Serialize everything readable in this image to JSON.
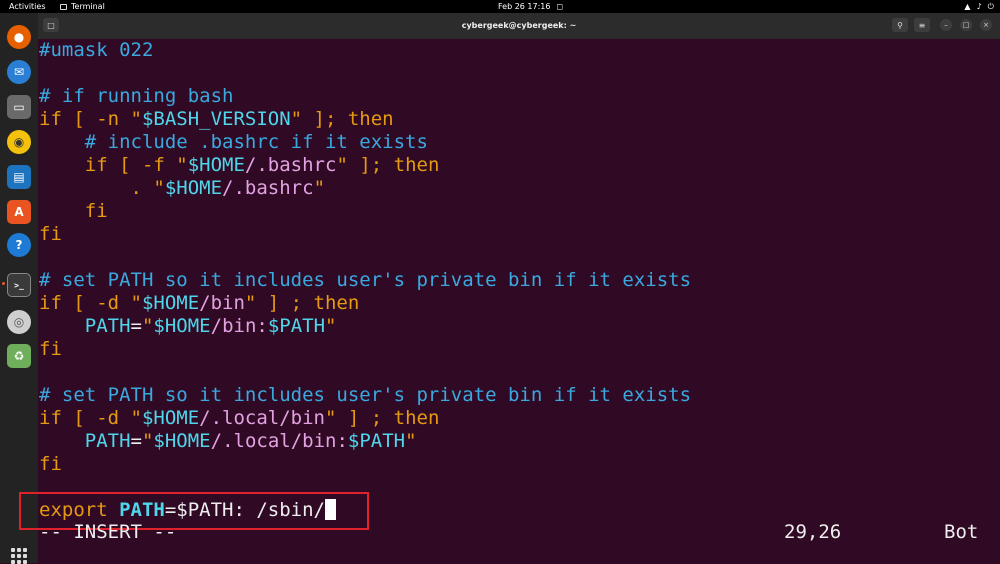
{
  "topbar": {
    "activities": "Activities",
    "app_name": "Terminal",
    "datetime": "Feb 26  17:16",
    "tray_icons": [
      "network-icon",
      "volume-icon",
      "power-icon"
    ]
  },
  "dock": {
    "apps": [
      {
        "name": "firefox",
        "icon": "firefox-icon",
        "color": "#e66000"
      },
      {
        "name": "thunderbird",
        "icon": "thunderbird-icon",
        "color": "#2a7fd4"
      },
      {
        "name": "files",
        "icon": "folder-icon",
        "color": "#6a6a6a"
      },
      {
        "name": "rhythmbox",
        "icon": "speaker-icon",
        "color": "#f4c20d"
      },
      {
        "name": "libreoffice-writer",
        "icon": "document-icon",
        "color": "#1e73be"
      },
      {
        "name": "app-center",
        "icon": "store-icon",
        "color": "#e95420"
      },
      {
        "name": "help",
        "icon": "help-icon",
        "color": "#1d7bd6"
      },
      {
        "name": "terminal",
        "icon": "terminal-icon",
        "color": "#3a3a3a"
      },
      {
        "name": "dvd",
        "icon": "disc-icon",
        "color": "#cfcfcf"
      },
      {
        "name": "trash",
        "icon": "trash-icon",
        "color": "#6fae5a"
      }
    ]
  },
  "window": {
    "title": "cybergeek@cybergeek: ~",
    "buttons": [
      "search-icon",
      "menu-icon",
      "minimize-icon",
      "maximize-icon",
      "close-icon"
    ]
  },
  "editor": {
    "lines": [
      {
        "row": 0,
        "segments": [
          {
            "cls": "c",
            "text": "#umask 022"
          }
        ]
      },
      {
        "row": 2,
        "segments": [
          {
            "cls": "c",
            "text": "# if running bash"
          }
        ]
      },
      {
        "row": 3,
        "segments": [
          {
            "cls": "k",
            "text": "if [ -n \""
          },
          {
            "cls": "v",
            "text": "$BASH_VERSION"
          },
          {
            "cls": "k",
            "text": "\" ]; then"
          }
        ]
      },
      {
        "row": 4,
        "segments": [
          {
            "cls": "c",
            "text": "    # include .bashrc if it exists"
          }
        ]
      },
      {
        "row": 5,
        "segments": [
          {
            "cls": "k",
            "text": "    if [ -f \""
          },
          {
            "cls": "v",
            "text": "$HOME"
          },
          {
            "cls": "s",
            "text": "/.bashrc"
          },
          {
            "cls": "k",
            "text": "\" ]; then"
          }
        ]
      },
      {
        "row": 6,
        "segments": [
          {
            "cls": "k",
            "text": "        . \""
          },
          {
            "cls": "v",
            "text": "$HOME"
          },
          {
            "cls": "s",
            "text": "/.bashrc"
          },
          {
            "cls": "k",
            "text": "\""
          }
        ]
      },
      {
        "row": 7,
        "segments": [
          {
            "cls": "k",
            "text": "    fi"
          }
        ]
      },
      {
        "row": 8,
        "segments": [
          {
            "cls": "k",
            "text": "fi"
          }
        ]
      },
      {
        "row": 10,
        "segments": [
          {
            "cls": "c",
            "text": "# set PATH so it includes user's private bin if it exists"
          }
        ]
      },
      {
        "row": 11,
        "segments": [
          {
            "cls": "k",
            "text": "if [ -d \""
          },
          {
            "cls": "v",
            "text": "$HOME"
          },
          {
            "cls": "s",
            "text": "/bin"
          },
          {
            "cls": "k",
            "text": "\" ] ; then"
          }
        ]
      },
      {
        "row": 12,
        "segments": [
          {
            "cls": "v",
            "text": "    PATH"
          },
          {
            "cls": "w",
            "text": "="
          },
          {
            "cls": "k",
            "text": "\""
          },
          {
            "cls": "v",
            "text": "$HOME"
          },
          {
            "cls": "s",
            "text": "/bin:"
          },
          {
            "cls": "v",
            "text": "$PATH"
          },
          {
            "cls": "k",
            "text": "\""
          }
        ]
      },
      {
        "row": 13,
        "segments": [
          {
            "cls": "k",
            "text": "fi"
          }
        ]
      },
      {
        "row": 15,
        "segments": [
          {
            "cls": "c",
            "text": "# set PATH so it includes user's private bin if it exists"
          }
        ]
      },
      {
        "row": 16,
        "segments": [
          {
            "cls": "k",
            "text": "if [ -d \""
          },
          {
            "cls": "v",
            "text": "$HOME"
          },
          {
            "cls": "s",
            "text": "/.local/bin"
          },
          {
            "cls": "k",
            "text": "\" ] ; then"
          }
        ]
      },
      {
        "row": 17,
        "segments": [
          {
            "cls": "v",
            "text": "    PATH"
          },
          {
            "cls": "w",
            "text": "="
          },
          {
            "cls": "k",
            "text": "\""
          },
          {
            "cls": "v",
            "text": "$HOME"
          },
          {
            "cls": "s",
            "text": "/.local/bin:"
          },
          {
            "cls": "v",
            "text": "$PATH"
          },
          {
            "cls": "k",
            "text": "\""
          }
        ]
      },
      {
        "row": 18,
        "segments": [
          {
            "cls": "k",
            "text": "fi"
          }
        ]
      },
      {
        "row": 20,
        "segments": [
          {
            "cls": "k",
            "text": "export "
          },
          {
            "cls": "b",
            "text": "PATH"
          },
          {
            "cls": "w",
            "text": "=$PATH: /sbin/"
          }
        ],
        "cursor": true
      }
    ],
    "mode": "-- INSERT --",
    "position": "29,26",
    "scroll": "Bot"
  },
  "colors": {
    "background": "#300a24",
    "comment": "#39a9e0",
    "keyword": "#e59a12",
    "string": "#e2a2e2",
    "variable": "#4fd6ea",
    "highlight_box": "#e0202a"
  }
}
